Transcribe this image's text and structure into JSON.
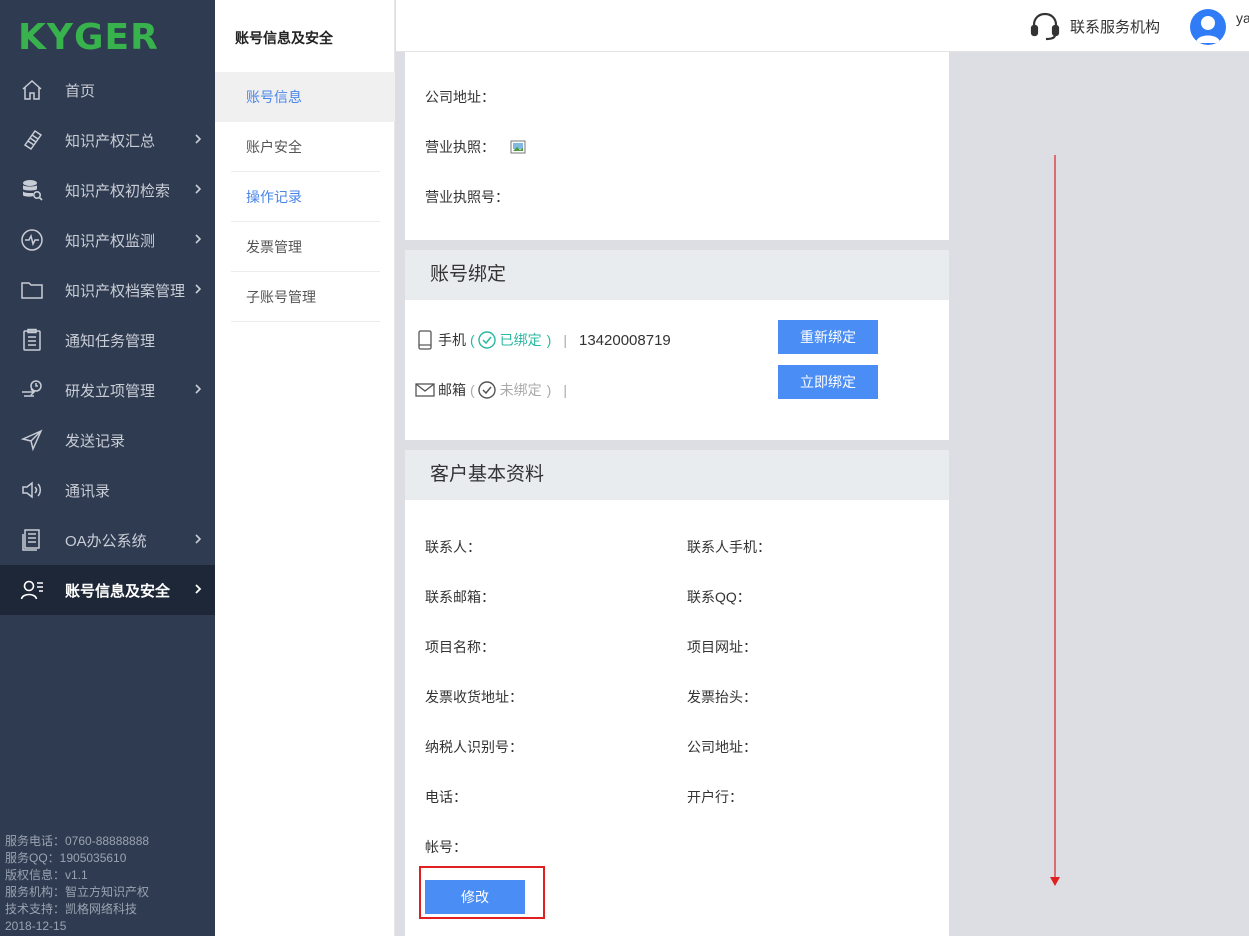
{
  "brand": {
    "logo_text": "KYGER"
  },
  "sidebar": {
    "items": [
      {
        "label": "首页",
        "icon": "home-icon",
        "arrow": false
      },
      {
        "label": "知识产权汇总",
        "icon": "notebook-icon",
        "arrow": true
      },
      {
        "label": "知识产权初检索",
        "icon": "database-search-icon",
        "arrow": true
      },
      {
        "label": "知识产权监测",
        "icon": "pulse-icon",
        "arrow": true
      },
      {
        "label": "知识产权档案管理",
        "icon": "folder-icon",
        "arrow": true
      },
      {
        "label": "通知任务管理",
        "icon": "clipboard-icon",
        "arrow": false
      },
      {
        "label": "研发立项管理",
        "icon": "clock-flow-icon",
        "arrow": true
      },
      {
        "label": "发送记录",
        "icon": "send-icon",
        "arrow": false
      },
      {
        "label": "通讯录",
        "icon": "speaker-icon",
        "arrow": false
      },
      {
        "label": "OA办公系统",
        "icon": "document-icon",
        "arrow": true
      },
      {
        "label": "账号信息及安全",
        "icon": "user-list-icon",
        "arrow": true,
        "active": true
      }
    ],
    "footer": [
      "服务电话：0760-88888888",
      "服务QQ：1905035610",
      "版权信息：v1.1",
      "服务机构：智立方知识产权",
      "技术支持：凯格网络科技",
      "2018-12-15"
    ]
  },
  "subnav": {
    "title": "账号信息及安全",
    "items": [
      {
        "label": "账号信息",
        "state": "current"
      },
      {
        "label": "账户安全",
        "state": "normal"
      },
      {
        "label": "操作记录",
        "state": "link"
      },
      {
        "label": "发票管理",
        "state": "normal"
      },
      {
        "label": "子账号管理",
        "state": "normal"
      }
    ]
  },
  "header": {
    "service_label": "联系服务机构",
    "username": "ya"
  },
  "company": {
    "address_label": "公司地址：",
    "license_label": "营业执照：",
    "license_no_label": "营业执照号："
  },
  "binding": {
    "title": "账号绑定",
    "phone_label": "手机",
    "phone_status": "已绑定",
    "phone_number": "13420008719",
    "email_label": "邮箱",
    "email_status": "未绑定",
    "rebind_button": "重新绑定",
    "bind_now_button": "立即绑定",
    "bound_color": "#2ab8a0",
    "unbound_color": "#aaaaaa"
  },
  "profile": {
    "title": "客户基本资料",
    "fields_left": [
      "联系人：",
      "联系邮箱：",
      "项目名称：",
      "发票收货地址：",
      "纳税人识别号：",
      "电话：",
      "帐号："
    ],
    "fields_right": [
      "联系人手机：",
      "联系QQ：",
      "项目网址：",
      "发票抬头：",
      "公司地址：",
      "开户行："
    ],
    "edit_button": "修改"
  },
  "colors": {
    "sidebar_bg": "#2f3b50",
    "accent": "#4a8df5",
    "highlight_border": "#e02020"
  }
}
